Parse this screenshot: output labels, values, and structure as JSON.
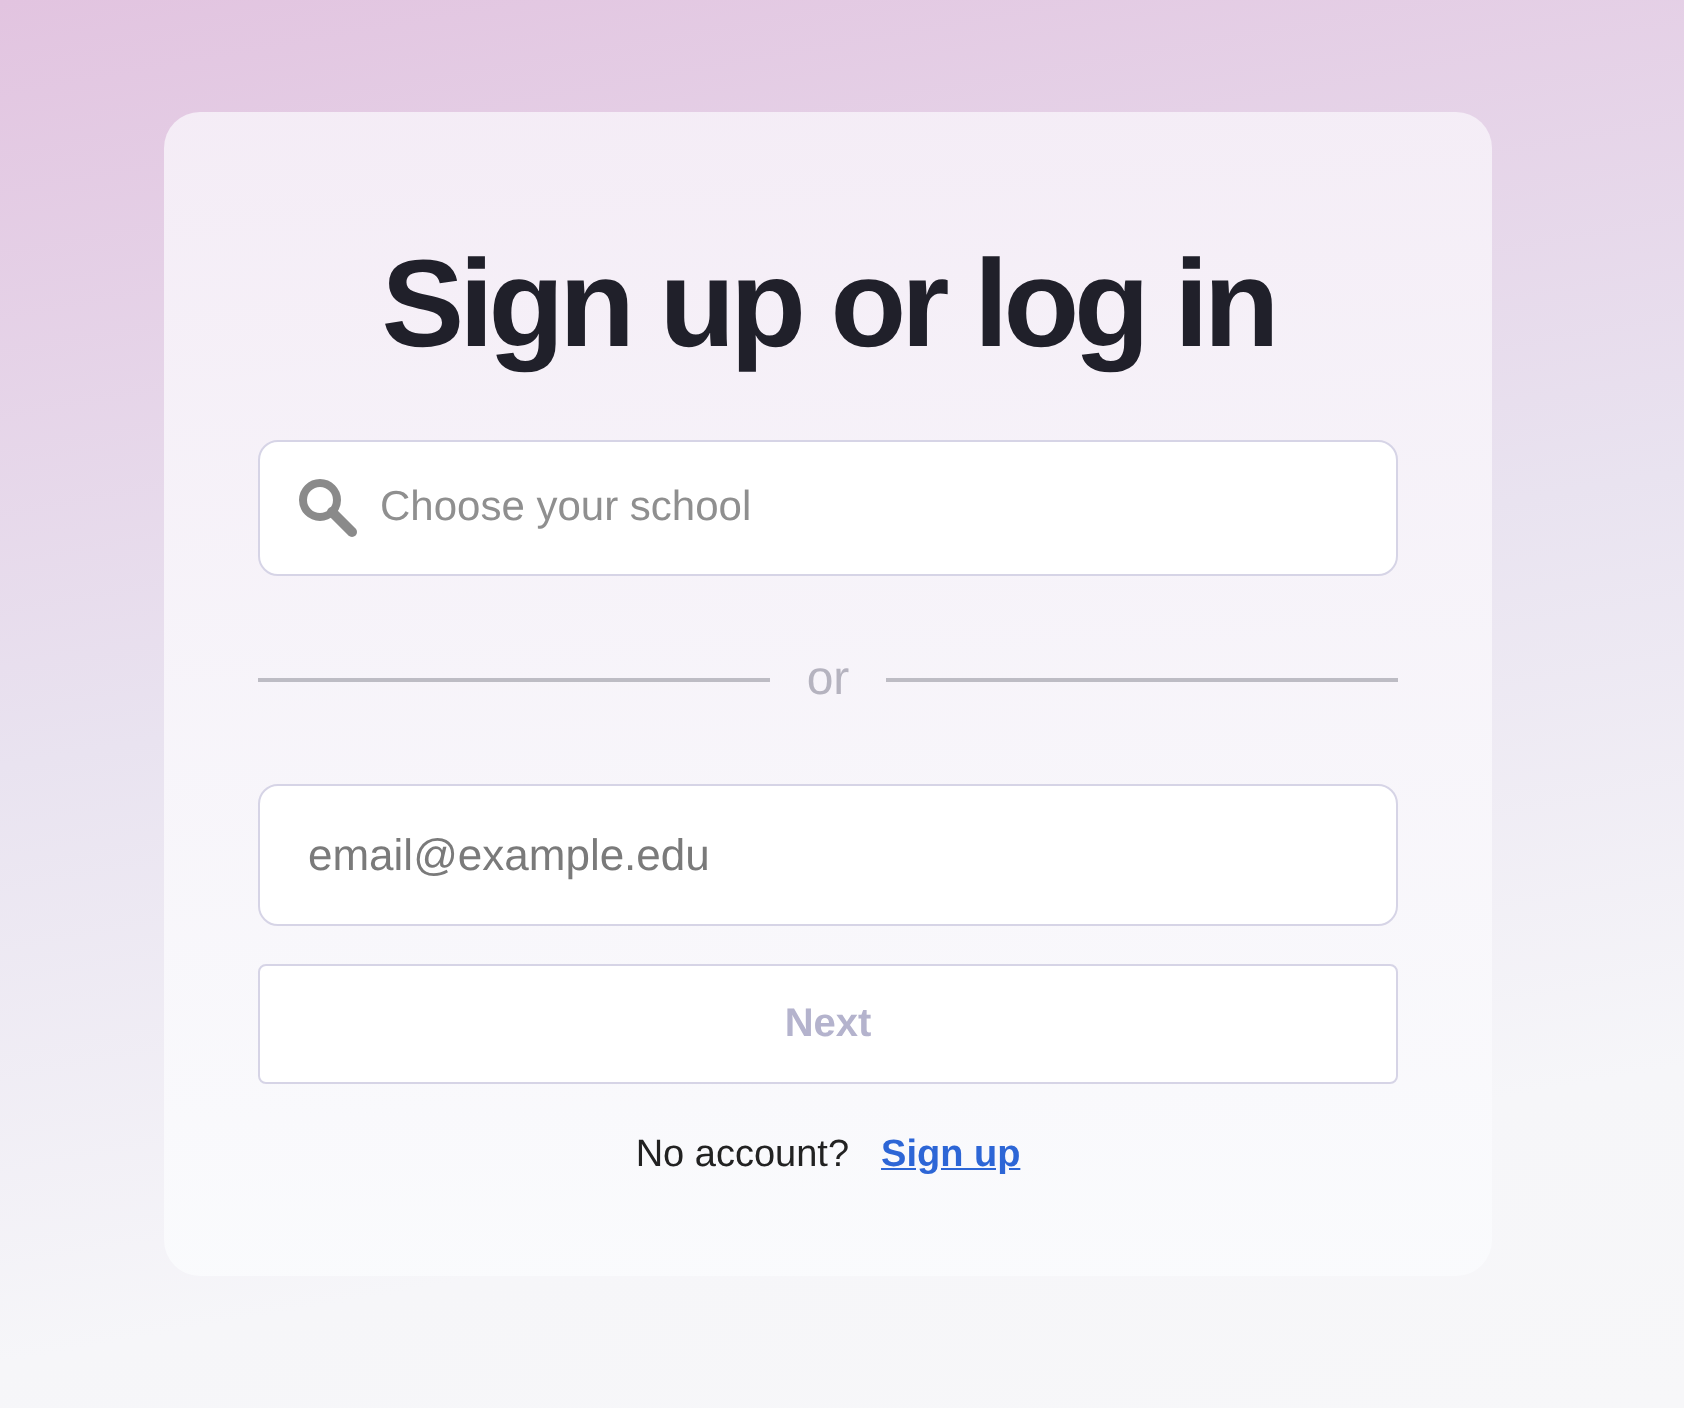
{
  "title": "Sign up or log in",
  "school_search": {
    "placeholder": "Choose your school"
  },
  "divider": {
    "label": "or"
  },
  "email": {
    "placeholder": "email@example.edu"
  },
  "next_button": {
    "label": "Next",
    "disabled": true
  },
  "footer": {
    "text": "No account?",
    "link": "Sign up"
  }
}
